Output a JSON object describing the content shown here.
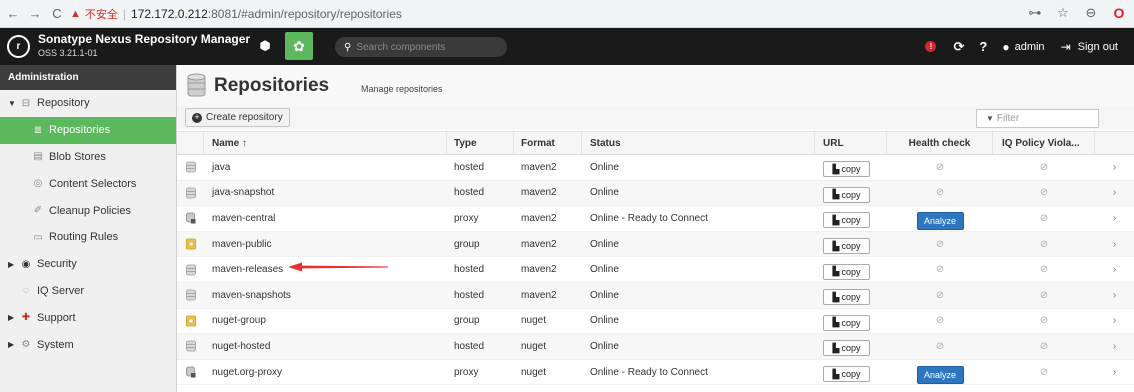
{
  "browser": {
    "insecure_label": "不安全",
    "url_host": "172.172.0.212",
    "url_path": ":8081/#admin/repository/repositories"
  },
  "header": {
    "brand_title": "Sonatype Nexus Repository Manager",
    "version": "OSS 3.21.1-01",
    "search_placeholder": "Search components",
    "user": "admin",
    "signout": "Sign out",
    "accent_color": "#5cb85c"
  },
  "sidebar": {
    "title": "Administration",
    "items": [
      {
        "label": "Repository",
        "icon": "db-icon",
        "level": 0,
        "expanded": true
      },
      {
        "label": "Repositories",
        "icon": "db-icon",
        "level": 1,
        "active": true
      },
      {
        "label": "Blob Stores",
        "icon": "blob-icon",
        "level": 1
      },
      {
        "label": "Content Selectors",
        "icon": "selector-icon",
        "level": 1
      },
      {
        "label": "Cleanup Policies",
        "icon": "broom-icon",
        "level": 1
      },
      {
        "label": "Routing Rules",
        "icon": "routing-icon",
        "level": 1
      },
      {
        "label": "Security",
        "icon": "security-icon",
        "level": 0
      },
      {
        "label": "IQ Server",
        "icon": "iq-icon",
        "level": 0
      },
      {
        "label": "Support",
        "icon": "support-icon",
        "level": 0
      },
      {
        "label": "System",
        "icon": "system-icon",
        "level": 0
      }
    ]
  },
  "page": {
    "title": "Repositories",
    "subtitle": "Manage repositories",
    "create_label": "Create repository",
    "filter_placeholder": "Filter"
  },
  "table": {
    "columns": {
      "name": "Name ↑",
      "type": "Type",
      "format": "Format",
      "status": "Status",
      "url": "URL",
      "health": "Health check",
      "iq": "IQ Policy Viola..."
    },
    "copy_label": "copy",
    "analyze_label": "Analyze",
    "rows": [
      {
        "name": "java",
        "type": "hosted",
        "format": "maven2",
        "status": "Online",
        "icon": "hosted",
        "health": "na"
      },
      {
        "name": "java-snapshot",
        "type": "hosted",
        "format": "maven2",
        "status": "Online",
        "icon": "hosted",
        "health": "na"
      },
      {
        "name": "maven-central",
        "type": "proxy",
        "format": "maven2",
        "status": "Online - Ready to Connect",
        "icon": "proxy",
        "health": "analyze"
      },
      {
        "name": "maven-public",
        "type": "group",
        "format": "maven2",
        "status": "Online",
        "icon": "group",
        "health": "na"
      },
      {
        "name": "maven-releases",
        "type": "hosted",
        "format": "maven2",
        "status": "Online",
        "icon": "hosted",
        "health": "na"
      },
      {
        "name": "maven-snapshots",
        "type": "hosted",
        "format": "maven2",
        "status": "Online",
        "icon": "hosted",
        "health": "na"
      },
      {
        "name": "nuget-group",
        "type": "group",
        "format": "nuget",
        "status": "Online",
        "icon": "group",
        "health": "na"
      },
      {
        "name": "nuget-hosted",
        "type": "hosted",
        "format": "nuget",
        "status": "Online",
        "icon": "hosted",
        "health": "na"
      },
      {
        "name": "nuget.org-proxy",
        "type": "proxy",
        "format": "nuget",
        "status": "Online - Ready to Connect",
        "icon": "proxy",
        "health": "analyze"
      }
    ]
  }
}
